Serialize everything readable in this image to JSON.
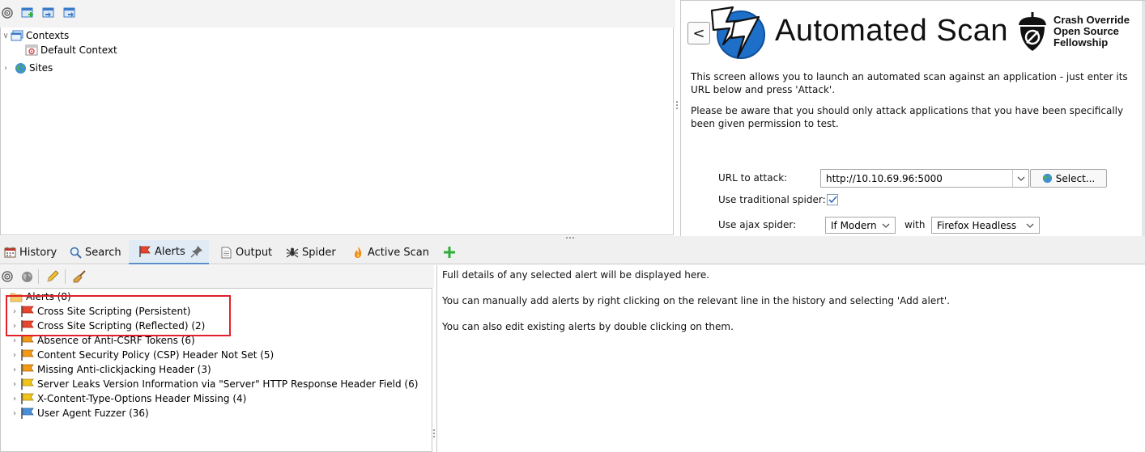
{
  "sites_panel": {
    "tree": [
      {
        "label": "Contexts",
        "expanded": true,
        "icon": "contexts-icon"
      },
      {
        "label": "Default Context",
        "icon": "default-context-icon"
      },
      {
        "label": "Sites",
        "expanded": false,
        "icon": "globe-icon"
      }
    ]
  },
  "quick_start": {
    "back_label": "<",
    "title": "Automated Scan",
    "brand": {
      "line1": "Crash Override",
      "line2": "Open Source",
      "line3": "Fellowship"
    },
    "paragraph1": "This screen allows you to launch an automated scan against  an application - just enter its URL below and press 'Attack'.",
    "paragraph2": "Please be aware that you should only attack applications that you have been specifically been given permission to test.",
    "url_label": "URL to attack:",
    "url_value": "http://10.10.69.96:5000",
    "select_label": "Select...",
    "traditional_label": "Use traditional spider:",
    "traditional_checked": true,
    "ajax_label": "Use ajax spider:",
    "ajax_value": "If Modern",
    "with_label": "with",
    "browser_value": "Firefox Headless"
  },
  "tabs": [
    {
      "label": "History",
      "icon": "history-icon"
    },
    {
      "label": "Search",
      "icon": "search-icon"
    },
    {
      "label": "Alerts",
      "icon": "alert-flag-icon",
      "active": true
    },
    {
      "label": "Output",
      "icon": "output-icon"
    },
    {
      "label": "Spider",
      "icon": "spider-icon"
    },
    {
      "label": "Active Scan",
      "icon": "flame-icon"
    }
  ],
  "alerts": {
    "root": "Alerts (8)",
    "items": [
      {
        "label": "Cross Site Scripting (Persistent)",
        "risk": "high"
      },
      {
        "label": "Cross Site Scripting (Reflected) (2)",
        "risk": "high"
      },
      {
        "label": "Absence of Anti-CSRF Tokens (6)",
        "risk": "medium"
      },
      {
        "label": "Content Security Policy (CSP) Header Not Set (5)",
        "risk": "medium"
      },
      {
        "label": "Missing Anti-clickjacking Header (3)",
        "risk": "medium"
      },
      {
        "label": "Server Leaks Version Information via \"Server\" HTTP Response Header Field (6)",
        "risk": "low"
      },
      {
        "label": "X-Content-Type-Options Header Missing (4)",
        "risk": "low"
      },
      {
        "label": "User Agent Fuzzer (36)",
        "risk": "info"
      }
    ]
  },
  "details": {
    "line1": "Full details of any selected alert will be displayed here.",
    "line2": "You can manually add alerts by right clicking on the relevant line in the history and selecting 'Add alert'.",
    "line3": "You can also edit existing alerts by double clicking on them."
  },
  "colors": {
    "high": "#e8452c",
    "medium": "#f29a16",
    "low": "#f0c419",
    "info": "#4a90d9",
    "highlight": "#e0202a",
    "accent": "#1e6fc8"
  }
}
